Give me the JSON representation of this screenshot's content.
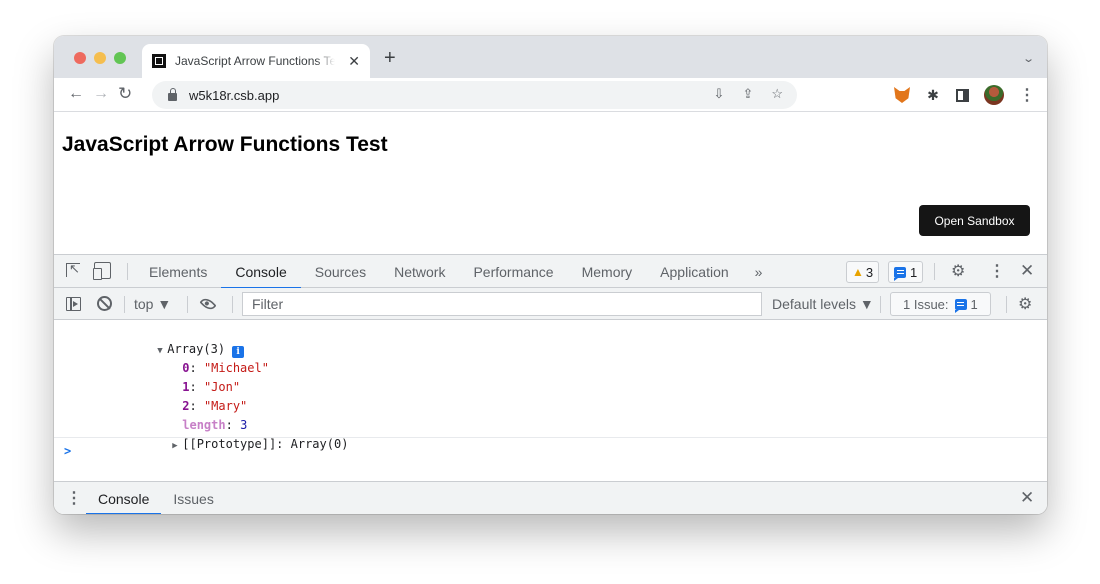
{
  "browser": {
    "tab": {
      "title": "JavaScript Arrow Functions Test",
      "favicon": "codesandbox-icon",
      "close_glyph": "✕"
    },
    "new_tab_glyph": "+",
    "tab_dropdown_glyph": "⌄",
    "nav": {
      "back_glyph": "←",
      "forward_glyph": "→",
      "reload_glyph": "C"
    },
    "url": "w5k18r.csb.app",
    "omnibox_icons": [
      "install-icon",
      "share-icon",
      "star-icon"
    ],
    "omnibox_glyphs": {
      "install": "⇩",
      "share": "⇪",
      "star": "☆"
    },
    "extensions": [
      "metamask-fox-icon",
      "puzzle-extensions-icon",
      "side-panel-icon",
      "profile-avatar",
      "menu-kebab-icon"
    ],
    "puzzle_glyph": "✱",
    "menu_glyph": "⋮"
  },
  "page": {
    "title": "JavaScript Arrow Functions Test",
    "open_sandbox_label": "Open Sandbox"
  },
  "devtools": {
    "tabs": [
      {
        "label": "Elements",
        "active": false
      },
      {
        "label": "Console",
        "active": true
      },
      {
        "label": "Sources",
        "active": false
      },
      {
        "label": "Network",
        "active": false
      },
      {
        "label": "Performance",
        "active": false
      },
      {
        "label": "Memory",
        "active": false
      },
      {
        "label": "Application",
        "active": false
      }
    ],
    "more_tabs_glyph": "»",
    "warnings_count": "3",
    "warning_glyph": "▲",
    "messages_count": "1",
    "gear_glyph": "⚙",
    "kebab_glyph": "⋮",
    "close_glyph": "✕",
    "toolbar": {
      "context": "top ▼",
      "filter_placeholder": "Filter",
      "filter_value": "",
      "levels": "Default levels ▼",
      "issues_label": "1 Issue:",
      "issues_count": "1"
    },
    "console": {
      "header": "Array(3)",
      "info_glyph": "i",
      "entries": [
        {
          "key": "0",
          "value": "\"Michael\""
        },
        {
          "key": "1",
          "value": "\"Jon\""
        },
        {
          "key": "2",
          "value": "\"Mary\""
        }
      ],
      "length_key": "length",
      "length_value": "3",
      "prototype_key": "[[Prototype]]",
      "prototype_value": "Array(0)",
      "prompt_glyph": ">"
    },
    "drawer": {
      "kebab_glyph": "⋮",
      "tabs": [
        {
          "label": "Console",
          "active": true
        },
        {
          "label": "Issues",
          "active": false
        }
      ],
      "close_glyph": "✕"
    }
  },
  "colors": {
    "accent": "#1a73e8",
    "warning": "#e8a300",
    "key": "#881391",
    "string": "#c41a16",
    "number": "#1a1aa6"
  }
}
